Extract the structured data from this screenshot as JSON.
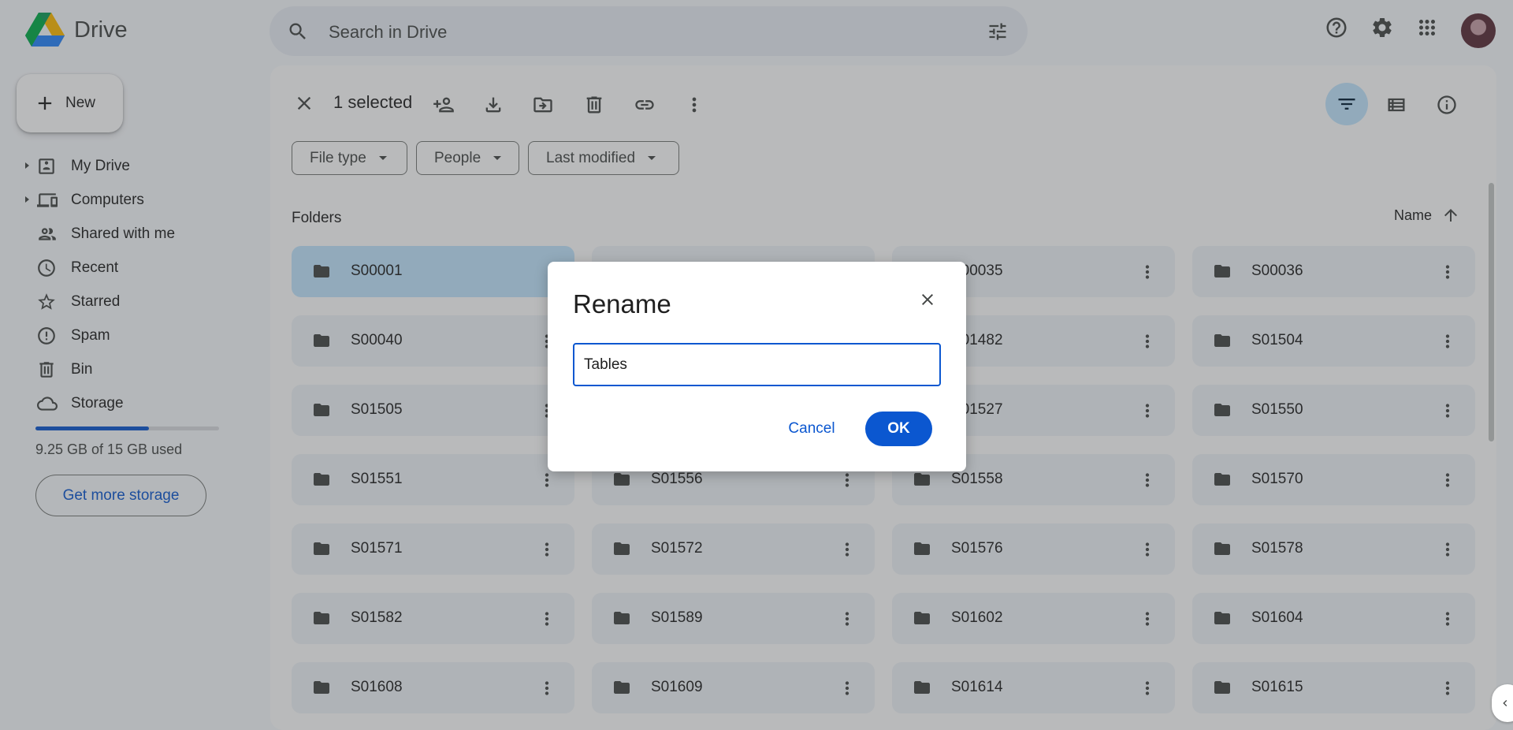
{
  "app": {
    "name": "Drive"
  },
  "search": {
    "placeholder": "Search in Drive"
  },
  "sidebar": {
    "new_label": "New",
    "items": [
      {
        "label": "My Drive",
        "icon": "my-drive-icon",
        "expandable": true
      },
      {
        "label": "Computers",
        "icon": "computers-icon",
        "expandable": true
      },
      {
        "label": "Shared with me",
        "icon": "shared-icon",
        "expandable": false
      },
      {
        "label": "Recent",
        "icon": "clock-icon",
        "expandable": false
      },
      {
        "label": "Starred",
        "icon": "star-icon",
        "expandable": false
      },
      {
        "label": "Spam",
        "icon": "spam-icon",
        "expandable": false
      },
      {
        "label": "Bin",
        "icon": "bin-icon",
        "expandable": false
      },
      {
        "label": "Storage",
        "icon": "cloud-icon",
        "expandable": false
      }
    ],
    "storage_text": "9.25 GB of 15 GB used",
    "storage_fraction": 0.617,
    "more_storage_label": "Get more storage"
  },
  "selection": {
    "count_text": "1 selected"
  },
  "filters": [
    {
      "label": "File type"
    },
    {
      "label": "People"
    },
    {
      "label": "Last modified"
    }
  ],
  "folders_title": "Folders",
  "sort_label": "Name",
  "folders": [
    "S00001",
    "",
    "S00035",
    "S00036",
    "S00040",
    "",
    "S01482",
    "S01504",
    "S01505",
    "",
    "S01527",
    "S01550",
    "S01551",
    "S01556",
    "S01558",
    "S01570",
    "S01571",
    "S01572",
    "S01576",
    "S01578",
    "S01582",
    "S01589",
    "S01602",
    "S01604",
    "S01608",
    "S01609",
    "S01614",
    "S01615"
  ],
  "selected_folder": "S00001",
  "dialog": {
    "title": "Rename",
    "value": "Tables",
    "cancel_label": "Cancel",
    "ok_label": "OK"
  },
  "colors": {
    "accent": "#0b57d0",
    "selected": "#c2e7ff",
    "folder_bg": "#f0f4f9"
  }
}
